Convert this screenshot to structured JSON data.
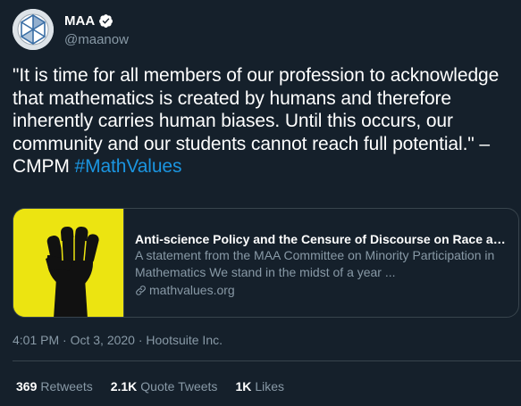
{
  "account": {
    "name": "MAA",
    "handle": "@maanow",
    "verified": true
  },
  "tweet": {
    "text_main": "\"It is time for all members of our profession to acknowledge that mathematics is created by humans and therefore inherently carries human biases. Until this occurs, our community and our students cannot reach full potential.\" –CMPM ",
    "hashtag": "#MathValues"
  },
  "card": {
    "title": "Anti-science Policy and the Censure of Discourse on Race and...",
    "description": "A statement from the MAA Committee on Minority Participation in Mathematics We stand in the midst of a year ...",
    "domain": "mathvalues.org"
  },
  "meta": {
    "time_date_source": "4:01 PM · Oct 3, 2020 · Hootsuite Inc."
  },
  "stats": {
    "retweets_count": "369",
    "retweets_label": "Retweets",
    "quote_count": "2.1K",
    "quote_label": "Quote Tweets",
    "likes_count": "1K",
    "likes_label": "Likes"
  },
  "colors": {
    "background": "#15202b",
    "text": "#ffffff",
    "secondary": "#8899a6",
    "accent": "#1b95e0",
    "border": "#38444d",
    "card_thumb_bg": "#ece411"
  }
}
